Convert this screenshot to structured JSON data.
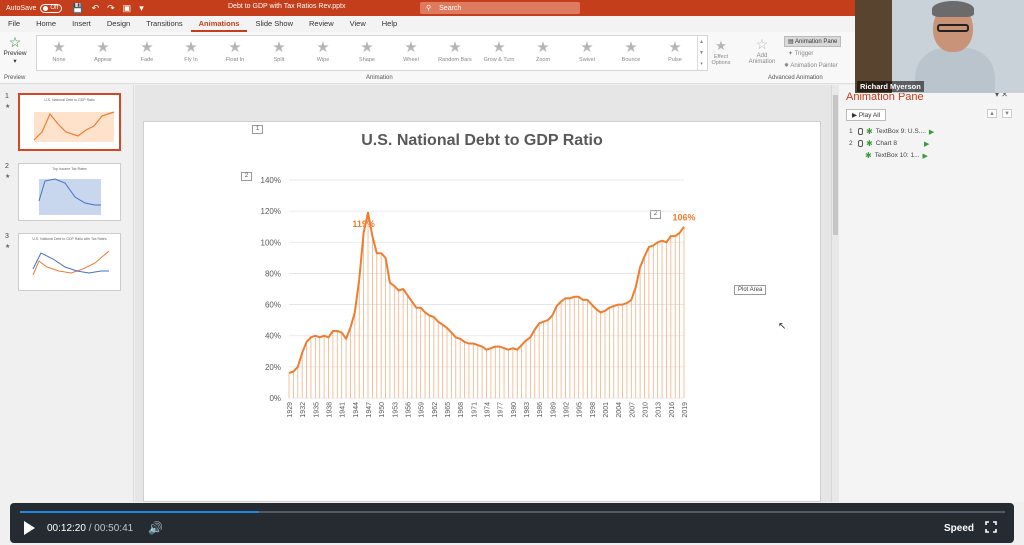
{
  "titlebar": {
    "autosave": "AutoSave",
    "autosave_state": "Off",
    "document_title": "Debt to GDP with Tax Ratios Rev.pptx",
    "search_placeholder": "Search"
  },
  "tabs": [
    "File",
    "Home",
    "Insert",
    "Design",
    "Transitions",
    "Animations",
    "Slide Show",
    "Review",
    "View",
    "Help"
  ],
  "active_tab": "Animations",
  "ribbon": {
    "preview_label": "Preview",
    "preview_group": "Preview",
    "animation_group": "Animation",
    "advanced_group": "Advanced Animation",
    "effects": [
      "None",
      "Appear",
      "Fade",
      "Fly In",
      "Float In",
      "Split",
      "Wipe",
      "Shape",
      "Wheel",
      "Random Bars",
      "Grow & Turn",
      "Zoom",
      "Swivel",
      "Bounce",
      "Pulse"
    ],
    "effect_options": "Effect Options",
    "add_animation": "Add Animation",
    "animation_pane_button": "Animation Pane",
    "trigger": "Trigger",
    "animation_painter": "Animation Painter"
  },
  "slides": [
    {
      "num": "1",
      "title": "U.S. National Debt to GDP Ratio"
    },
    {
      "num": "2",
      "title": "Top Income Tax Rates"
    },
    {
      "num": "3",
      "title": "U.S. National Debt to GDP Ratio with Tax Rates"
    }
  ],
  "slide": {
    "title": "U.S. National Debt to GDP Ratio",
    "tag_title": "1",
    "tag_chart": "2",
    "tag_label": "2",
    "plot_tooltip": "Plot Area"
  },
  "animation_pane": {
    "title": "Animation Pane",
    "play_all": "Play All",
    "items": [
      {
        "num": "1",
        "label": "TextBox 9: U.S...."
      },
      {
        "num": "2",
        "label": "Chart 8"
      },
      {
        "num": "",
        "label": "TextBox 10: 1..."
      }
    ]
  },
  "webcam": {
    "name": "Richard Myerson"
  },
  "video": {
    "current_time": "00:12:20",
    "separator": "/",
    "duration": "00:50:41",
    "speed_label": "Speed",
    "progress": 0.243
  },
  "chart_data": {
    "type": "area",
    "title": "U.S. National Debt to GDP Ratio",
    "x_start": 1929,
    "x_end": 2019,
    "tick_labels": [
      "1929",
      "1932",
      "1935",
      "1938",
      "1941",
      "1944",
      "1947",
      "1950",
      "1953",
      "1956",
      "1959",
      "1962",
      "1965",
      "1968",
      "1971",
      "1974",
      "1977",
      "1980",
      "1983",
      "1986",
      "1989",
      "1992",
      "1995",
      "1998",
      "2001",
      "2004",
      "2007",
      "2010",
      "2013",
      "2016",
      "2019"
    ],
    "ylim": [
      0,
      140
    ],
    "y_ticks": [
      "0%",
      "20%",
      "40%",
      "60%",
      "80%",
      "100%",
      "120%",
      "140%"
    ],
    "values": [
      16,
      17,
      20,
      29,
      36,
      39,
      40,
      39,
      40,
      39,
      43,
      43,
      42,
      38,
      45,
      55,
      76,
      106,
      119,
      104,
      93,
      93,
      90,
      74,
      72,
      69,
      70,
      66,
      62,
      58,
      58,
      55,
      53,
      52,
      49,
      47,
      45,
      42,
      39,
      38,
      36,
      35,
      35,
      34,
      33,
      31,
      32,
      33,
      33,
      32,
      31,
      32,
      31,
      34,
      37,
      39,
      44,
      48,
      49,
      50,
      53,
      59,
      62,
      64,
      64,
      65,
      65,
      63,
      63,
      60,
      57,
      55,
      56,
      58,
      59,
      60,
      60,
      61,
      63,
      71,
      84,
      91,
      97,
      98,
      100,
      101,
      100,
      104,
      104,
      106,
      110
    ],
    "annotations": [
      {
        "x": 1946,
        "label": "119%"
      },
      {
        "x": 2019,
        "label": "106%"
      }
    ],
    "color": "#ed7d31",
    "grid": true
  }
}
